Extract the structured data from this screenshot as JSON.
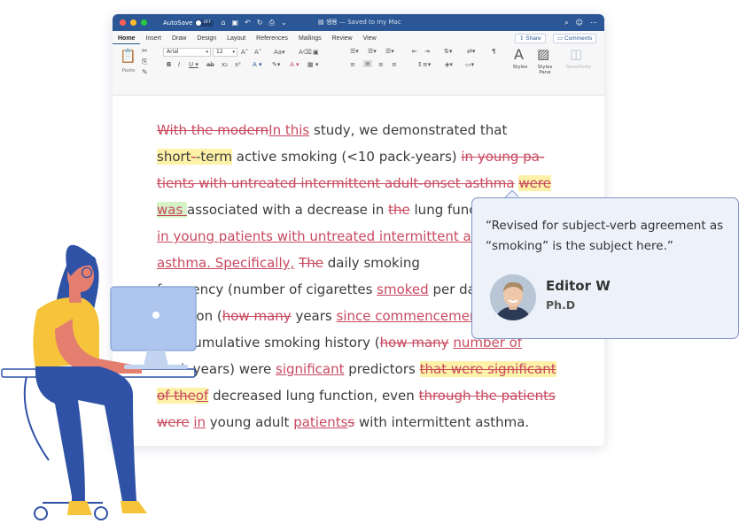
{
  "titlebar": {
    "autosave_label": "AutoSave",
    "autosave_state": "OFF",
    "doc_name": "생용",
    "doc_status": "— Saved to my Mac"
  },
  "tabs": [
    "Home",
    "Insert",
    "Draw",
    "Design",
    "Layout",
    "References",
    "Mailings",
    "Review",
    "View"
  ],
  "share_label": "Share",
  "comments_label": "Comments",
  "ribbon": {
    "paste_label": "Paste",
    "font_name": "Arial",
    "font_size": "12",
    "styles_label": "Styles",
    "styles_pane_label": "Styles\nPane",
    "sensitivity_label": "Sensitivity"
  },
  "document": {
    "lines": [
      [
        [
          "del",
          "With the modern"
        ],
        [
          "ins",
          "In this"
        ],
        [
          "txt",
          " study, we demonstrated that"
        ]
      ],
      [
        [
          "hl",
          "short"
        ],
        [
          "hldel",
          "-"
        ],
        [
          "hl",
          "-term"
        ],
        [
          "txt",
          " active smoking (<10 pack-years) "
        ],
        [
          "del",
          "in young pa-"
        ]
      ],
      [
        [
          "del",
          "tients with untreated intermittent adult-onset asthma"
        ],
        [
          "txt",
          " "
        ],
        [
          "hldel",
          "were "
        ]
      ],
      [
        [
          "hlgins",
          "was "
        ],
        [
          "txt",
          "associated with a decrease in "
        ],
        [
          "del",
          "the"
        ],
        [
          "txt",
          " lung function and AHR"
        ]
      ],
      [
        [
          "ins",
          "in young patients with untreated intermittent adult-onset"
        ]
      ],
      [
        [
          "ins",
          "asthma. Specifically,"
        ],
        [
          "txt",
          "  "
        ],
        [
          "del",
          "The"
        ],
        [
          "txt",
          "  daily smoking"
        ]
      ],
      [
        [
          "txt",
          "frequency (number of cigarettes "
        ],
        [
          "ins",
          "smoked"
        ],
        [
          "txt",
          " per day) and"
        ]
      ],
      [
        [
          "txt",
          "duration ("
        ],
        [
          "del",
          "how many"
        ],
        [
          "txt",
          " years "
        ],
        [
          "ins",
          "since commencement"
        ]
      ],
      [
        [
          "txt",
          "and cumulative smoking history ("
        ],
        [
          "del",
          "how many"
        ],
        [
          "txt",
          " "
        ],
        [
          "ins",
          "number of"
        ]
      ],
      [
        [
          "txt",
          "pack-years) were "
        ],
        [
          "ins",
          "significant"
        ],
        [
          "txt",
          " predictors "
        ],
        [
          "hldel",
          "that were significant"
        ]
      ],
      [
        [
          "hldel",
          "of the"
        ],
        [
          "hlins",
          "of"
        ],
        [
          "txt",
          " decreased lung function, even "
        ],
        [
          "del",
          "through the patients"
        ]
      ],
      [
        [
          "del",
          "were"
        ],
        [
          "txt",
          " "
        ],
        [
          "ins",
          "in"
        ],
        [
          "txt",
          " young adult "
        ],
        [
          "ins",
          "patients"
        ],
        [
          "del",
          "s"
        ],
        [
          "txt",
          " with intermittent asthma."
        ]
      ]
    ]
  },
  "comment": {
    "text": "“Revised for subject-verb agreement as “smoking” is the subject here.”",
    "editor_name": "Editor W",
    "editor_degree": "Ph.D"
  },
  "colors": {
    "title_bar": "#2b5797",
    "track_change": "#c8495f",
    "highlight_yellow": "#fdf2a8",
    "highlight_green": "#d6f2c8",
    "comment_bg": "#edf1f9",
    "comment_border": "#7f97c7",
    "shirt": "#f5c43a",
    "pants": "#2f52a6",
    "monitor": "#aec6ee"
  }
}
